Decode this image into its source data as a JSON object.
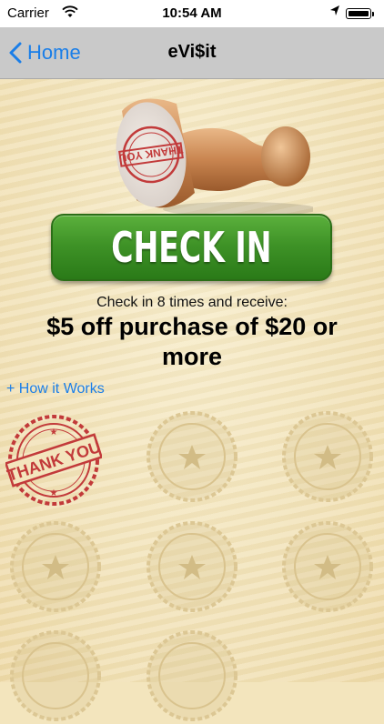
{
  "status_bar": {
    "carrier": "Carrier",
    "time": "10:54 AM",
    "icons": [
      "wifi-icon",
      "location-arrow-icon",
      "battery-icon"
    ]
  },
  "nav": {
    "back_label": "Home",
    "title": "eVi$it"
  },
  "hero": {
    "stamp_text": "THANK YOU"
  },
  "checkin": {
    "button_label": "CHECK IN",
    "subtext": "Check in 8 times and receive:",
    "reward": "$5 off purchase of $20 or more",
    "how_link": "+ How it Works"
  },
  "punch_card": {
    "stamped_text": "THANK YOU",
    "stamped_count": 1,
    "slots": [
      "stamped",
      "empty",
      "empty",
      "empty",
      "empty",
      "empty",
      "empty",
      "empty"
    ]
  },
  "colors": {
    "accent_blue": "#1a7ee8",
    "button_green": "#3f9327",
    "stamp_red": "#c23a3a",
    "background": "#f3e5bd"
  }
}
